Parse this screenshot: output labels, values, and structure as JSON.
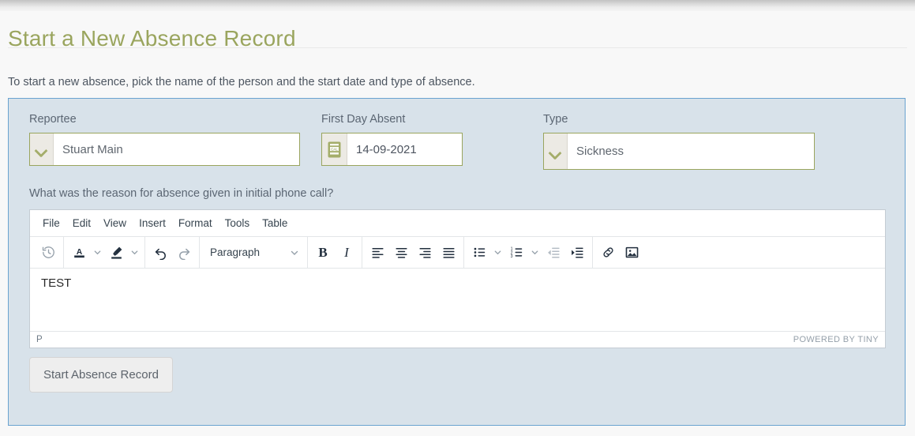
{
  "page": {
    "title": "Start a New Absence Record",
    "intro": "To start a new absence, pick the name of the person and the start date and type of absence."
  },
  "form": {
    "reportee": {
      "label": "Reportee",
      "value": "Stuart Main",
      "dropdown_icon": "chevron-down-icon"
    },
    "first_day_absent": {
      "label": "First Day Absent",
      "value": "14-09-2021",
      "icon": "calendar-icon",
      "icon_text": "CAL"
    },
    "type": {
      "label": "Type",
      "value": "Sickness",
      "dropdown_icon": "chevron-down-icon"
    },
    "question_label": "What was the reason for absence given in initial phone call?",
    "submit_label": "Start Absence Record"
  },
  "editor": {
    "menubar": [
      "File",
      "Edit",
      "View",
      "Insert",
      "Format",
      "Tools",
      "Table"
    ],
    "format_select": "Paragraph",
    "toolbar_icons": [
      "restore-draft-icon",
      "text-color-icon",
      "text-color-caret-icon",
      "highlight-color-icon",
      "highlight-color-caret-icon",
      "undo-icon",
      "redo-icon",
      "bold-icon",
      "italic-icon",
      "align-left-icon",
      "align-center-icon",
      "align-right-icon",
      "align-justify-icon",
      "bullet-list-icon",
      "bullet-list-caret-icon",
      "numbered-list-icon",
      "numbered-list-caret-icon",
      "outdent-icon",
      "indent-icon",
      "link-icon",
      "image-icon"
    ],
    "bold_label": "B",
    "italic_label": "I",
    "content": "TEST",
    "status_path": "P",
    "status_brand": "POWERED BY TINY"
  },
  "colors": {
    "title": "#9aa55e",
    "panel_bg": "#d8e2ea",
    "panel_border": "#6aa3d0",
    "field_border": "#9aa55e",
    "accent_olive": "#a4ad6a"
  }
}
